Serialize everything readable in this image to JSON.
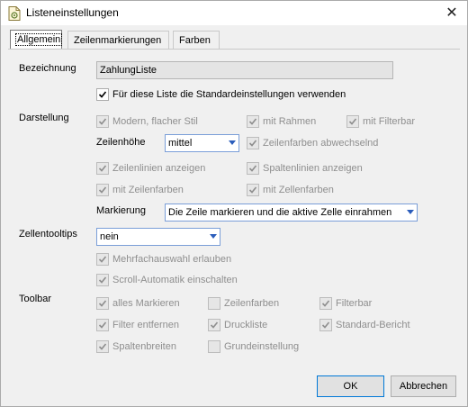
{
  "window": {
    "title": "Listeneinstellungen",
    "close_glyph": "✕"
  },
  "tabs": [
    {
      "label": "Allgemein",
      "active": true
    },
    {
      "label": "Zeilenmarkierungen",
      "active": false
    },
    {
      "label": "Farben",
      "active": false
    }
  ],
  "bezeichnung": {
    "label": "Bezeichnung",
    "value": "ZahlungListe",
    "use_default": {
      "label": "Für diese Liste die Standardeinstellungen verwenden",
      "checked": true
    }
  },
  "darstellung": {
    "label": "Darstellung",
    "modern": {
      "label": "Modern, flacher Stil",
      "checked": true
    },
    "rahmen": {
      "label": "mit Rahmen",
      "checked": true
    },
    "filterbar": {
      "label": "mit Filterbar",
      "checked": true
    },
    "zeilenhoehe_label": "Zeilenhöhe",
    "zeilenhoehe_value": "mittel",
    "zeilenfarben_abw": {
      "label": "Zeilenfarben abwechselnd",
      "checked": true
    },
    "zeilenlinien": {
      "label": "Zeilenlinien anzeigen",
      "checked": true
    },
    "spaltenlinien": {
      "label": "Spaltenlinien anzeigen",
      "checked": true
    },
    "mit_zeilenfarben": {
      "label": "mit Zeilenfarben",
      "checked": true
    },
    "mit_zellenfarben": {
      "label": "mit Zellenfarben",
      "checked": true
    },
    "markierung_label": "Markierung",
    "markierung_value": "Die Zeile markieren und die aktive Zelle einrahmen"
  },
  "zellentooltips": {
    "label": "Zellentooltips",
    "value": "nein",
    "mehrfach": {
      "label": "Mehrfachauswahl erlauben",
      "checked": true
    },
    "scroll": {
      "label": "Scroll-Automatik einschalten",
      "checked": true
    }
  },
  "toolbar": {
    "label": "Toolbar",
    "alles_markieren": {
      "label": "alles Markieren",
      "checked": true
    },
    "zeilenfarben": {
      "label": "Zeilenfarben",
      "checked": false
    },
    "filterbar": {
      "label": "Filterbar",
      "checked": true
    },
    "filter_entfernen": {
      "label": "Filter entfernen",
      "checked": true
    },
    "druckliste": {
      "label": "Druckliste",
      "checked": true
    },
    "standard_bericht": {
      "label": "Standard-Bericht",
      "checked": true
    },
    "spaltenbreiten": {
      "label": "Spaltenbreiten",
      "checked": true
    },
    "grundeinstellung": {
      "label": "Grundeinstellung",
      "checked": false
    }
  },
  "buttons": {
    "ok": "OK",
    "cancel": "Abbrechen"
  },
  "colors": {
    "accent": "#0078d7",
    "disabled_text": "#8e8e8e"
  }
}
